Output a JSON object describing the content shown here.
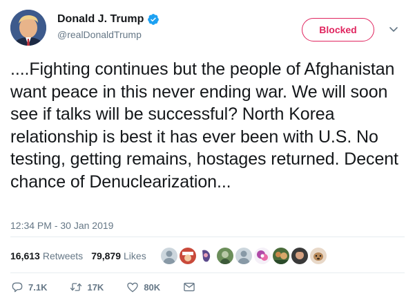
{
  "author": {
    "display_name": "Donald J. Trump",
    "handle": "@realDonaldTrump",
    "verified_icon": "verified-badge-icon"
  },
  "follow_button": {
    "label": "Blocked",
    "color": "#e0245e"
  },
  "tweet": {
    "text": "....Fighting continues but the people of Afghanistan want peace in this never ending war. We will soon see if talks will be successful? North Korea relationship is best it has ever been with U.S. No testing, getting remains, hostages returned. Decent chance of Denuclearization...",
    "timestamp": "12:34 PM - 30 Jan 2019"
  },
  "stats": {
    "retweets_count": "16,613",
    "retweets_label": "Retweets",
    "likes_count": "79,879",
    "likes_label": "Likes",
    "liker_avatars": 9
  },
  "actions": {
    "reply_count": "7.1K",
    "retweet_count": "17K",
    "like_count": "80K",
    "icons": [
      "reply-icon",
      "retweet-icon",
      "like-icon",
      "direct-message-icon"
    ]
  },
  "colors": {
    "text": "#14171a",
    "secondary": "#657786",
    "verified": "#1da1f2",
    "divider": "#e6ecf0"
  }
}
